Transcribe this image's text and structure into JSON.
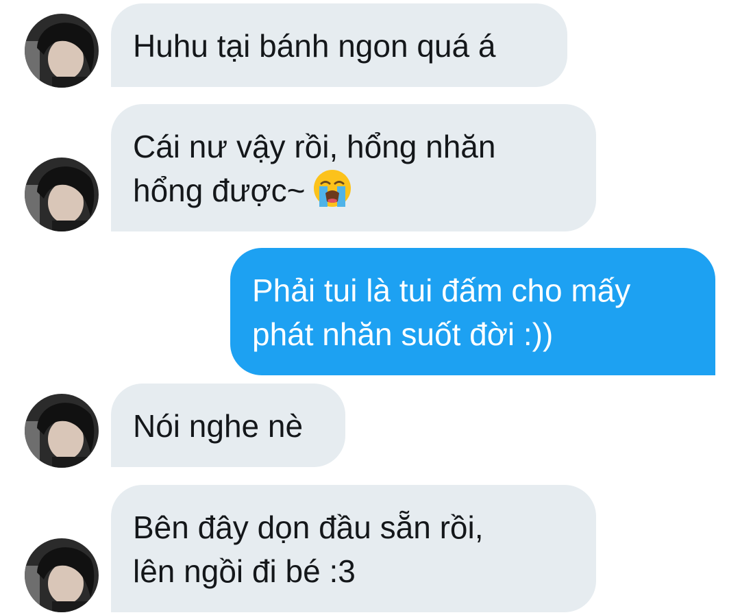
{
  "messages": [
    {
      "side": "received",
      "lines": [
        "Huhu tại bánh ngon quá á"
      ]
    },
    {
      "side": "received",
      "lines": [
        "Cái nư vậy rồi, hổng nhăn",
        "hổng được~"
      ],
      "emoji": "loudly-crying-face-icon"
    },
    {
      "side": "sent",
      "lines": [
        "Phải tui là tui đấm cho mấy",
        "phát nhăn suốt đời :))"
      ]
    },
    {
      "side": "received",
      "lines": [
        "Nói nghe nè"
      ]
    },
    {
      "side": "received",
      "lines": [
        "Bên đây dọn đầu sẵn rồi,",
        "lên ngồi đi bé :3"
      ]
    }
  ],
  "colors": {
    "received_bubble": "#e6ecf0",
    "sent_bubble": "#1da1f2",
    "received_text": "#14171a",
    "sent_text": "#ffffff"
  }
}
